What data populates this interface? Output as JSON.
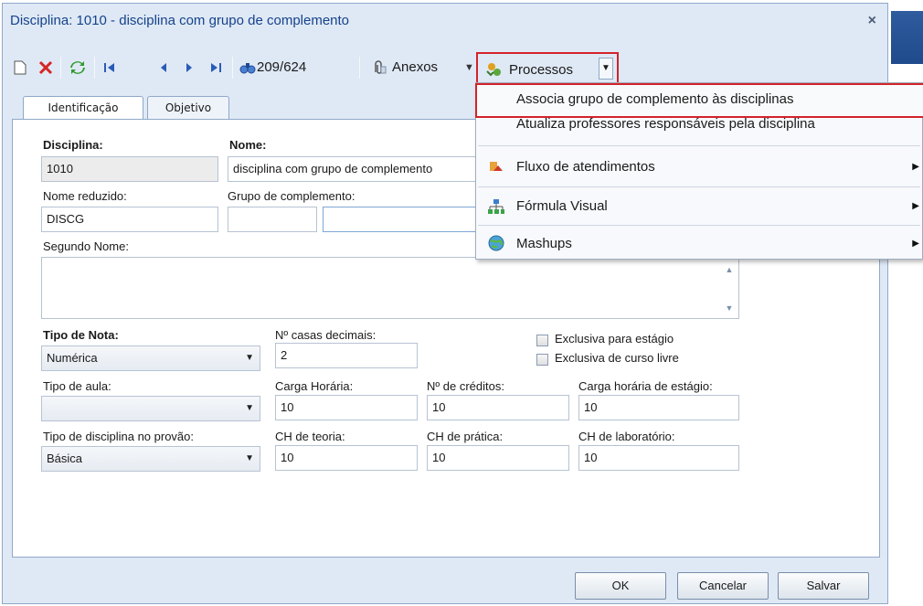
{
  "window": {
    "title": "Disciplina: 1010 - disciplina com grupo de complemento",
    "close": "×"
  },
  "toolbar": {
    "counter": "209/624",
    "anexos": "Anexos",
    "processos": "Processos",
    "icons": [
      "new-record-icon",
      "delete-icon",
      "refresh-icon",
      "first-record-icon",
      "previous-record-icon",
      "next-record-icon",
      "last-record-icon",
      "find-icon",
      "paperclip-icon",
      "processos-icon"
    ]
  },
  "tabs": [
    {
      "label": "Identificação",
      "active": true
    },
    {
      "label": "Objetivo",
      "active": false
    }
  ],
  "form": {
    "disciplina_label": "Disciplina:",
    "disciplina_value": "1010",
    "nome_label": "Nome:",
    "nome_value": "disciplina com grupo de complemento",
    "nome_reduzido_label": "Nome reduzido:",
    "nome_reduzido_value": "DISCG",
    "grupo_label": "Grupo de complemento:",
    "grupo_code": "",
    "grupo_desc": "",
    "segundo_nome_label": "Segundo Nome:",
    "segundo_nome_value": "",
    "tipo_nota_label": "Tipo de Nota:",
    "tipo_nota_value": "Numérica",
    "casas_label": "Nº casas decimais:",
    "casas_value": "2",
    "exclusiva_estagio_label": "Exclusiva para estágio",
    "exclusiva_livre_label": "Exclusiva de curso livre",
    "tipo_aula_label": "Tipo de aula:",
    "tipo_aula_value": "",
    "carga_label": "Carga Horária:",
    "carga_value": "10",
    "creditos_label": "Nº de créditos:",
    "creditos_value": "10",
    "carga_estagio_label": "Carga horária de estágio:",
    "carga_estagio_value": "10",
    "tipo_disc_label": "Tipo de disciplina no provão:",
    "tipo_disc_value": "Básica",
    "ch_teoria_label": "CH de teoria:",
    "ch_teoria_value": "10",
    "ch_pratica_label": "CH de prática:",
    "ch_pratica_value": "10",
    "ch_lab_label": "CH de laboratório:",
    "ch_lab_value": "10"
  },
  "buttons": {
    "ok": "OK",
    "cancelar": "Cancelar",
    "salvar": "Salvar"
  },
  "menu": {
    "items": [
      {
        "label": "Associa grupo de complemento às disciplinas",
        "highlighted": true
      },
      {
        "label": "Atualiza professores responsáveis pela disciplina"
      },
      {
        "label": "Fluxo de atendimentos",
        "icon": "workflow-icon",
        "submenu": true
      },
      {
        "label": "Fórmula Visual",
        "icon": "org-chart-icon",
        "submenu": true
      },
      {
        "label": "Mashups",
        "icon": "globe-icon",
        "submenu": true
      }
    ]
  },
  "colors": {
    "highlight": "#d2232a",
    "title": "#15428b",
    "frame": "#dfe9f5"
  }
}
